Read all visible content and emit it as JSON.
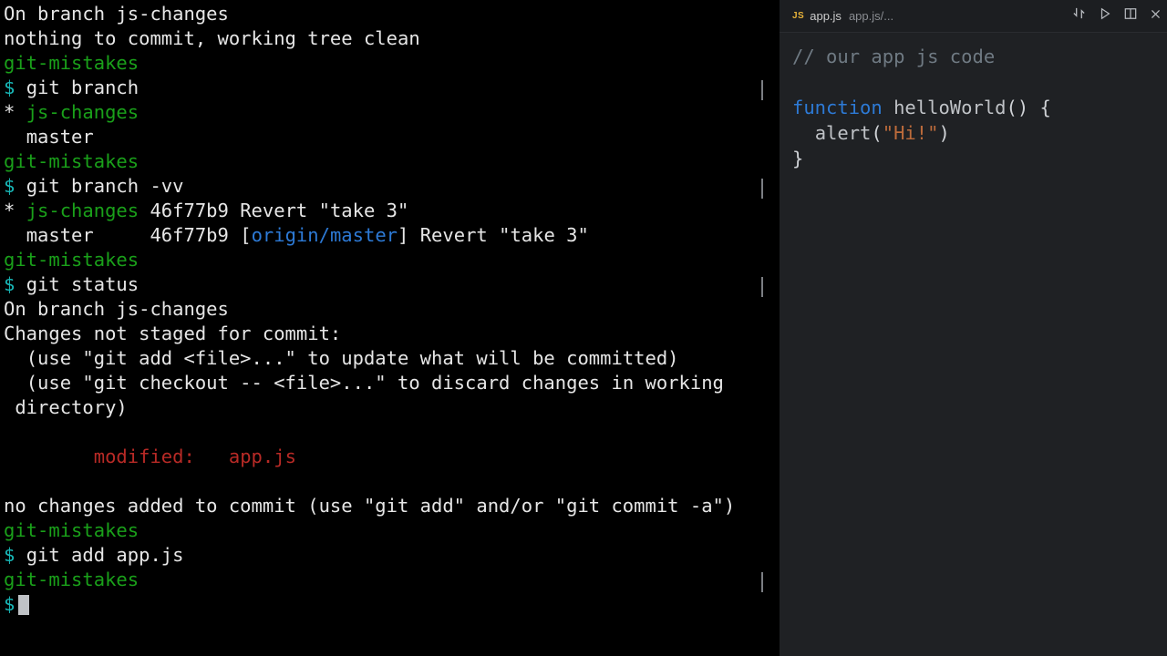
{
  "terminal": {
    "repo": "git-mistakes",
    "prompt": "$",
    "status1": {
      "l1": "On branch js-changes",
      "l2": "nothing to commit, working tree clean"
    },
    "cmd_branch": "git branch",
    "branch_list": {
      "current_mark": "*",
      "current": "js-changes",
      "other": "master"
    },
    "cmd_branch_vv": "git branch -vv",
    "branch_vv": {
      "cur": {
        "mark": "*",
        "name": "js-changes",
        "hash": "46f77b9",
        "msg": "Revert \"take 3\""
      },
      "oth": {
        "name": "master",
        "hash": "46f77b9",
        "upstream": "origin/master",
        "msg": "Revert \"take 3\""
      }
    },
    "cmd_status": "git status",
    "status2": {
      "l1": "On branch js-changes",
      "l2": "Changes not staged for commit:",
      "l3": "  (use \"git add <file>...\" to update what will be committed)",
      "l4a": "  (use \"git checkout -- <file>...\" to discard changes in working",
      "l4b": " directory)",
      "mod_label": "modified:",
      "mod_file": "app.js",
      "out": "no changes added to commit (use \"git add\" and/or \"git commit -a\")"
    },
    "cmd_add": "git add app.js"
  },
  "editor": {
    "tab": {
      "icon": "JS",
      "name": "app.js",
      "path": "app.js/..."
    },
    "code": {
      "comment": "// our app js code",
      "kw_function": "function",
      "fn_name": "helloWorld",
      "paren_open": "() {",
      "indent": "  ",
      "call": "alert",
      "arg": "\"Hi!\"",
      "paren_close": ")",
      "brace_close": "}"
    }
  }
}
